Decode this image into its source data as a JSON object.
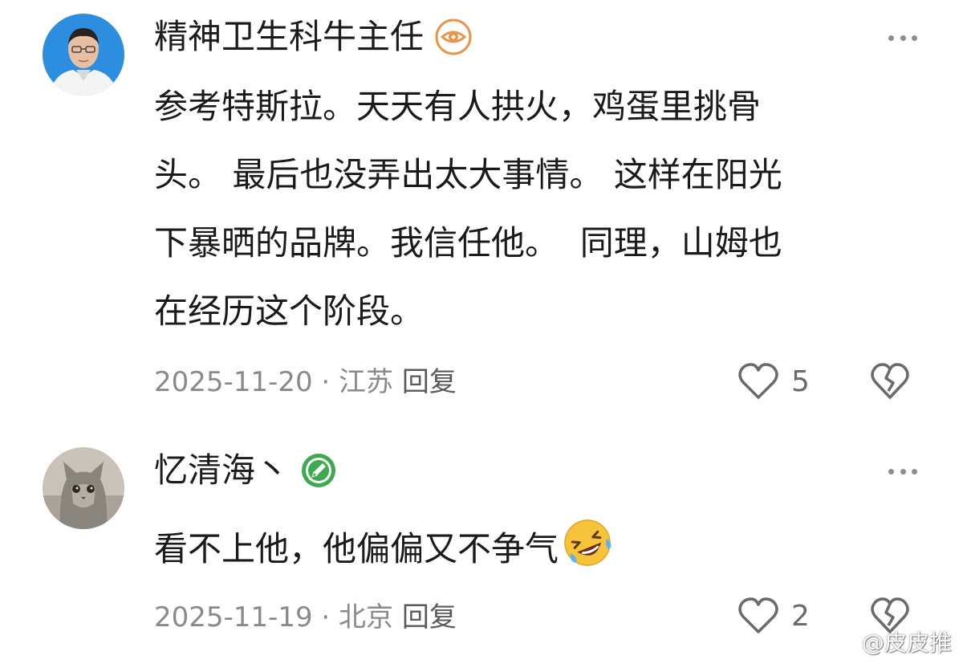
{
  "comments": [
    {
      "username": "精神卫生科牛主任",
      "badge_icon": "eye-badge-icon",
      "content": "参考特斯拉。天天有人拱火，鸡蛋里挑骨\n头。 最后也没弄出太大事情。 这样在阳光\n下暴晒的品牌。我信任他。  同理，山姆也\n在经历这个阶段。",
      "date": "2025-11-20",
      "location": "江苏",
      "reply_label": "回复",
      "likes": "5"
    },
    {
      "username": "忆清海丶",
      "badge_icon": "pencil-badge-icon",
      "content": "看不上他，他偏偏又不争气",
      "emoji": "rolling-laughing-emoji",
      "date": "2025-11-19",
      "location": "北京",
      "reply_label": "回复",
      "likes": "2"
    }
  ],
  "separator": " · ",
  "watermark": "@皮皮推",
  "colors": {
    "meta": "#8a8a8a",
    "badge_orange": "#e8954a",
    "badge_green": "#3eaa4e",
    "icon_gray": "#6a6a6a"
  }
}
